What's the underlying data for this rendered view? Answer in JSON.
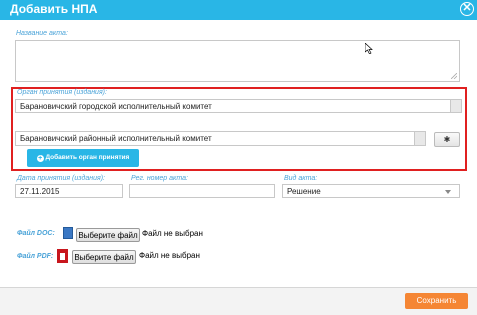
{
  "dialog": {
    "title": "Добавить НПА",
    "close_glyph": "✕"
  },
  "fields": {
    "act_name_label": "Название акта:",
    "organ_label": "Орган принятия (издания):",
    "organ_1": "Барановичский городской исполнительный комитет",
    "organ_2": "Барановичский районный исполнительный комитет",
    "add_organ_label": "Добавить орган принятия",
    "add_organ_icon": "plus-circle-icon",
    "date_label": "Дата принятия (издания):",
    "date_value": "27.11.2015",
    "reg_label": "Рег. номер акта:",
    "reg_value": "",
    "type_label": "Вид акта:",
    "type_value": "Решение"
  },
  "files": {
    "doc_label": "Файл DOC:",
    "pdf_label": "Файл PDF:",
    "choose_label": "Выберите файл",
    "no_file_text": "Файл не выбран"
  },
  "footer": {
    "save_label": "Сохранить"
  },
  "colors": {
    "accent": "#29b6e6",
    "save": "#f58634",
    "highlight": "#e02020"
  }
}
